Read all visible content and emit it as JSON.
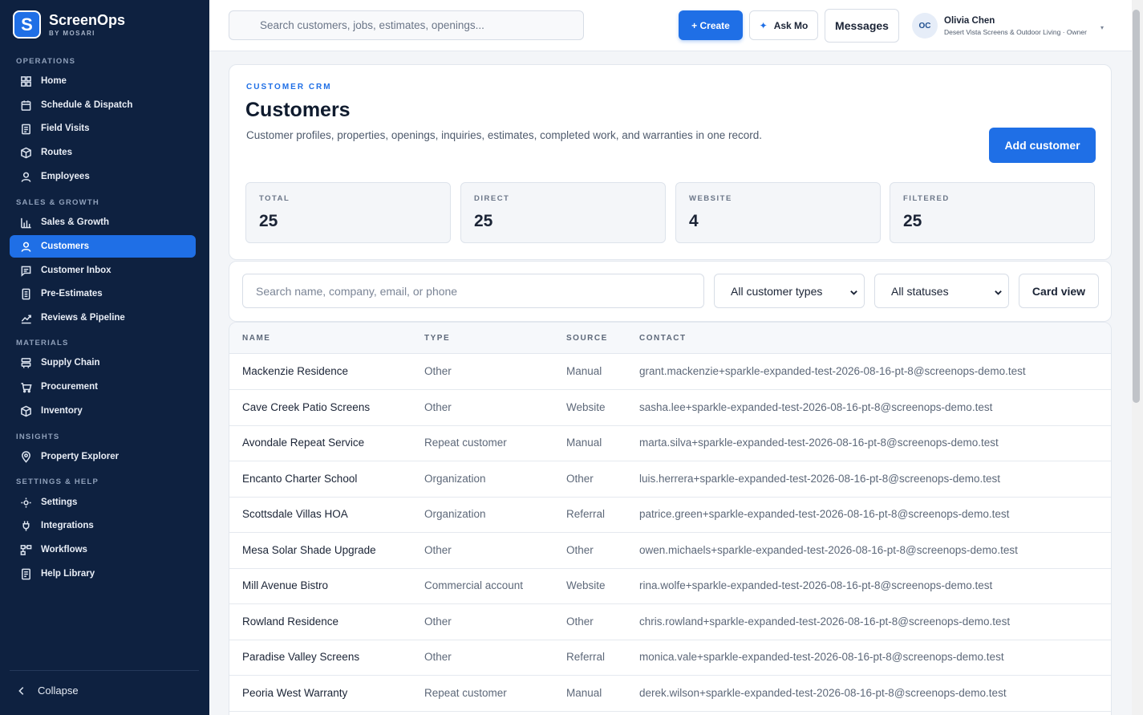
{
  "brand": {
    "logo_letter": "S",
    "name": "ScreenOps",
    "sub": "BY MOSARI"
  },
  "sidebar": {
    "sections": [
      {
        "title": "OPERATIONS",
        "items": [
          {
            "label": "Home",
            "icon": "grid-icon"
          },
          {
            "label": "Schedule & Dispatch",
            "icon": "calendar-icon"
          },
          {
            "label": "Field Visits",
            "icon": "clipboard-icon"
          },
          {
            "label": "Routes",
            "icon": "cube-icon"
          },
          {
            "label": "Employees",
            "icon": "person-icon"
          }
        ]
      },
      {
        "title": "SALES & GROWTH",
        "items": [
          {
            "label": "Sales & Growth",
            "icon": "bar-chart-icon"
          },
          {
            "label": "Customers",
            "icon": "person-icon",
            "active": true
          },
          {
            "label": "Customer Inbox",
            "icon": "chat-icon"
          },
          {
            "label": "Pre-Estimates",
            "icon": "document-icon"
          },
          {
            "label": "Reviews & Pipeline",
            "icon": "trend-icon"
          }
        ]
      },
      {
        "title": "MATERIALS",
        "items": [
          {
            "label": "Supply Chain",
            "icon": "layers-icon"
          },
          {
            "label": "Procurement",
            "icon": "cart-icon"
          },
          {
            "label": "Inventory",
            "icon": "box-icon"
          }
        ]
      },
      {
        "title": "INSIGHTS",
        "items": [
          {
            "label": "Property Explorer",
            "icon": "map-pin-icon"
          }
        ]
      },
      {
        "title": "SETTINGS & HELP",
        "items": [
          {
            "label": "Settings",
            "icon": "gear-icon"
          },
          {
            "label": "Integrations",
            "icon": "plug-icon"
          },
          {
            "label": "Workflows",
            "icon": "workflow-icon"
          },
          {
            "label": "Help Library",
            "icon": "book-icon"
          }
        ]
      }
    ],
    "collapse_label": "Collapse"
  },
  "topbar": {
    "search_placeholder": "Search customers, jobs, estimates, openings...",
    "create_label": "+ Create",
    "askmo_label": "Ask Mo",
    "messages_label": "Messages",
    "user": {
      "initials": "OC",
      "name": "Olivia Chen",
      "org": "Desert Vista Screens & Outdoor Living · Owner"
    }
  },
  "header": {
    "eyebrow": "CUSTOMER CRM",
    "title": "Customers",
    "description": "Customer profiles, properties, openings, inquiries, estimates, completed work, and warranties in one record.",
    "add_button": "Add customer",
    "stats": [
      {
        "label": "TOTAL",
        "value": "25"
      },
      {
        "label": "DIRECT",
        "value": "25"
      },
      {
        "label": "WEBSITE",
        "value": "4"
      },
      {
        "label": "FILTERED",
        "value": "25"
      }
    ]
  },
  "filters": {
    "search_placeholder": "Search name, company, email, or phone",
    "type_select": "All customer types",
    "status_select": "All statuses",
    "view_button": "Card view"
  },
  "table": {
    "columns": [
      "NAME",
      "TYPE",
      "SOURCE",
      "CONTACT"
    ],
    "rows": [
      [
        "Mackenzie Residence",
        "Other",
        "Manual",
        "grant.mackenzie+sparkle-expanded-test-2026-08-16-pt-8@screenops-demo.test"
      ],
      [
        "Cave Creek Patio Screens",
        "Other",
        "Website",
        "sasha.lee+sparkle-expanded-test-2026-08-16-pt-8@screenops-demo.test"
      ],
      [
        "Avondale Repeat Service",
        "Repeat customer",
        "Manual",
        "marta.silva+sparkle-expanded-test-2026-08-16-pt-8@screenops-demo.test"
      ],
      [
        "Encanto Charter School",
        "Organization",
        "Other",
        "luis.herrera+sparkle-expanded-test-2026-08-16-pt-8@screenops-demo.test"
      ],
      [
        "Scottsdale Villas HOA",
        "Organization",
        "Referral",
        "patrice.green+sparkle-expanded-test-2026-08-16-pt-8@screenops-demo.test"
      ],
      [
        "Mesa Solar Shade Upgrade",
        "Other",
        "Other",
        "owen.michaels+sparkle-expanded-test-2026-08-16-pt-8@screenops-demo.test"
      ],
      [
        "Mill Avenue Bistro",
        "Commercial account",
        "Website",
        "rina.wolfe+sparkle-expanded-test-2026-08-16-pt-8@screenops-demo.test"
      ],
      [
        "Rowland Residence",
        "Other",
        "Other",
        "chris.rowland+sparkle-expanded-test-2026-08-16-pt-8@screenops-demo.test"
      ],
      [
        "Paradise Valley Screens",
        "Other",
        "Referral",
        "monica.vale+sparkle-expanded-test-2026-08-16-pt-8@screenops-demo.test"
      ],
      [
        "Peoria West Warranty",
        "Repeat customer",
        "Manual",
        "derek.wilson+sparkle-expanded-test-2026-08-16-pt-8@screenops-demo.test"
      ]
    ]
  },
  "colors": {
    "accent": "#1f6fe6",
    "sidebar_bg": "#0e2140"
  }
}
